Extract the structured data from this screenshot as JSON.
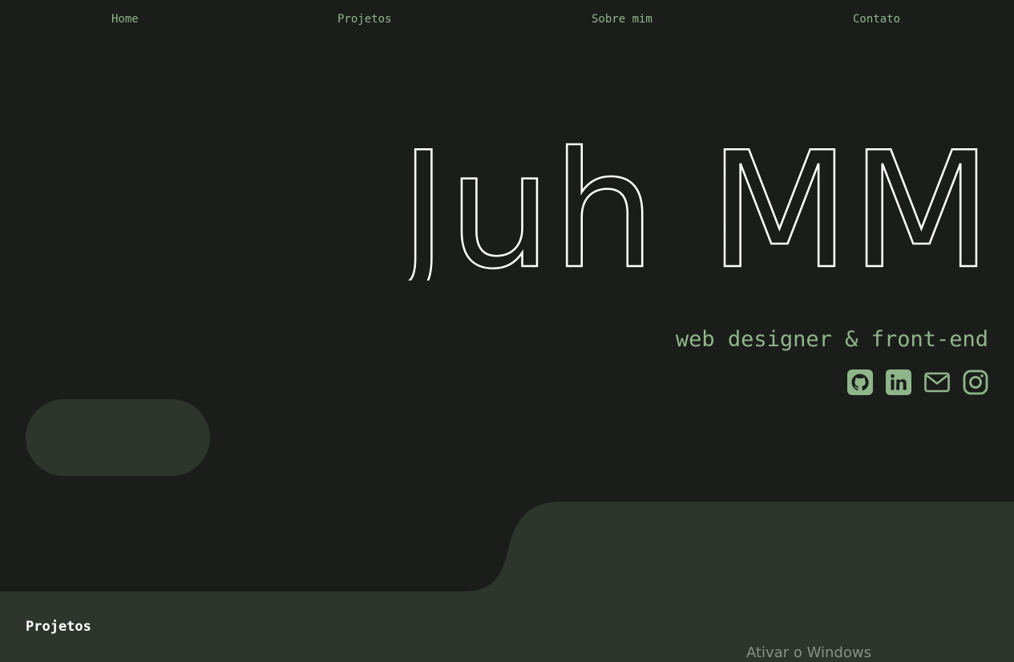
{
  "nav": {
    "items": [
      {
        "label": "Home"
      },
      {
        "label": "Projetos"
      },
      {
        "label": "Sobre mim"
      },
      {
        "label": "Contato"
      }
    ]
  },
  "hero": {
    "title": "Juh MM",
    "subtitle": "web designer & front-end"
  },
  "socials": {
    "icons": [
      "github-icon",
      "linkedin-icon",
      "email-icon",
      "instagram-icon"
    ]
  },
  "section": {
    "title": "Projetos"
  },
  "system": {
    "watermark": "Ativar o Windows"
  },
  "colors": {
    "background": "#1b1d1b",
    "accent": "#8fb68a",
    "panel": "#2d352d",
    "title_stroke": "#ffffff"
  }
}
